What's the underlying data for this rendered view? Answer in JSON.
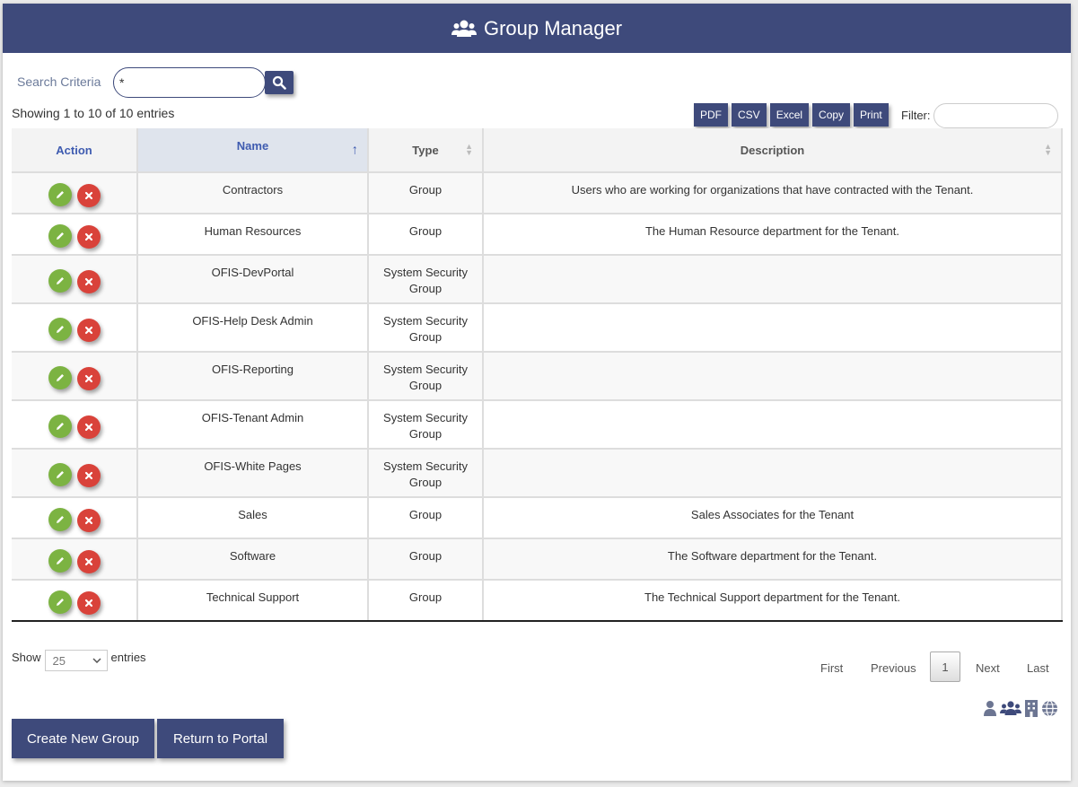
{
  "header": {
    "title": "Group Manager",
    "icon": "users-icon"
  },
  "search": {
    "label": "Search Criteria",
    "value": "*"
  },
  "info": {
    "showing": "Showing 1 to 10 of 10 entries"
  },
  "export_buttons": [
    "PDF",
    "CSV",
    "Excel",
    "Copy",
    "Print"
  ],
  "filter": {
    "label": "Filter:",
    "value": ""
  },
  "table": {
    "columns": [
      "Action",
      "Name",
      "Type",
      "Description"
    ],
    "rows": [
      {
        "name": "Contractors",
        "type": "Group",
        "description": "Users who are working for organizations that have contracted with the Tenant."
      },
      {
        "name": "Human Resources",
        "type": "Group",
        "description": "The Human Resource department for the Tenant."
      },
      {
        "name": "OFIS-DevPortal",
        "type": "System Security Group",
        "description": ""
      },
      {
        "name": "OFIS-Help Desk Admin",
        "type": "System Security Group",
        "description": ""
      },
      {
        "name": "OFIS-Reporting",
        "type": "System Security Group",
        "description": ""
      },
      {
        "name": "OFIS-Tenant Admin",
        "type": "System Security Group",
        "description": ""
      },
      {
        "name": "OFIS-White Pages",
        "type": "System Security Group",
        "description": ""
      },
      {
        "name": "Sales",
        "type": "Group",
        "description": "Sales Associates for the Tenant"
      },
      {
        "name": "Software",
        "type": "Group",
        "description": "The Software department for the Tenant."
      },
      {
        "name": "Technical Support",
        "type": "Group",
        "description": "The Technical Support department for the Tenant."
      }
    ]
  },
  "length_menu": {
    "prefix": "Show",
    "value": "25",
    "suffix": "entries"
  },
  "pagination": {
    "first": "First",
    "previous": "Previous",
    "current": "1",
    "next": "Next",
    "last": "Last"
  },
  "footer_buttons": {
    "create": "Create New Group",
    "return": "Return to Portal"
  },
  "colors": {
    "primary": "#3e4a7b",
    "edit": "#7cb342",
    "delete": "#d9423a"
  }
}
